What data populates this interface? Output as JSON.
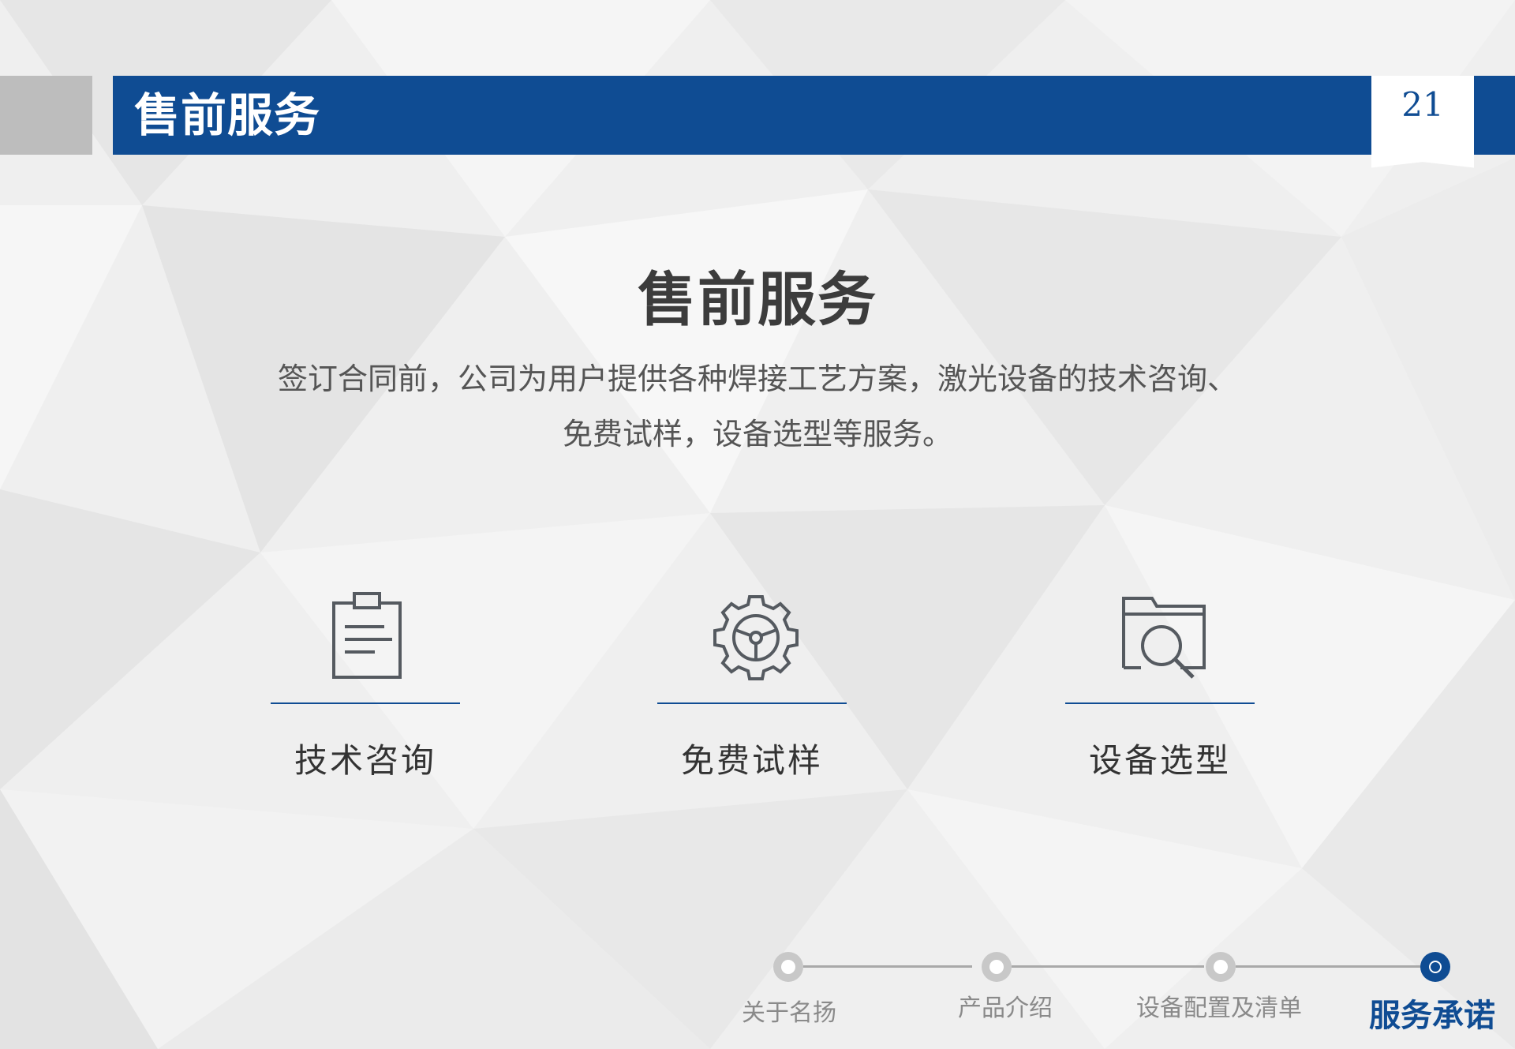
{
  "header": {
    "title": "售前服务",
    "page_number": "21"
  },
  "main": {
    "title": "售前服务",
    "description_lines": [
      "签订合同前，公司为用户提供各种焊接工艺方案，激光设备的技术咨询、",
      "免费试样，设备选型等服务。"
    ]
  },
  "services": [
    {
      "label": "技术咨询",
      "icon": "clipboard-icon"
    },
    {
      "label": "免费试样",
      "icon": "gear-icon"
    },
    {
      "label": "设备选型",
      "icon": "folder-search-icon"
    }
  ],
  "nav": {
    "items": [
      {
        "label": "关于名扬",
        "active": false
      },
      {
        "label": "产品介绍",
        "active": false
      },
      {
        "label": "设备配置及清单",
        "active": false
      },
      {
        "label": "服务承诺",
        "active": true
      }
    ]
  },
  "colors": {
    "brand_blue": "#0f4c93",
    "header_gray": "#bdbdbd",
    "background": "#efefef"
  }
}
